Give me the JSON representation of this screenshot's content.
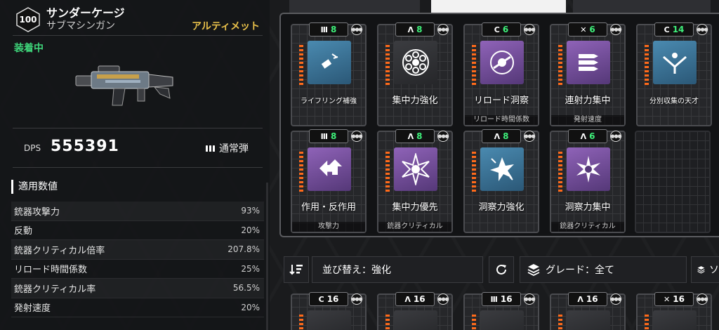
{
  "weapon": {
    "level": "100",
    "name": "サンダーケージ",
    "type": "サブマシンガン",
    "rarity": "アルティメット",
    "status": "装着中",
    "dps_label": "DPS",
    "dps_value": "555391",
    "ammo_label": "通常弾"
  },
  "stats": {
    "title": "適用数値",
    "rows": [
      {
        "label": "銃器攻撃力",
        "value": "93%"
      },
      {
        "label": "反動",
        "value": "20%"
      },
      {
        "label": "銃器クリティカル倍率",
        "value": "207.8%"
      },
      {
        "label": "リロード時間係数",
        "value": "25%"
      },
      {
        "label": "銃器クリティカル率",
        "value": "56.5%"
      },
      {
        "label": "発射速度",
        "value": "20%"
      }
    ]
  },
  "modules": [
    {
      "name": "ライフリング補強",
      "cost": "8",
      "polarity": "Ⅲ",
      "sub": "",
      "art": "blue",
      "glyph": "bullet-icon"
    },
    {
      "name": "集中力強化",
      "cost": "8",
      "polarity": "Λ",
      "sub": "",
      "art": "dark",
      "glyph": "cylinder-icon"
    },
    {
      "name": "リロード洞察",
      "cost": "6",
      "polarity": "C",
      "sub": "リロード時間係数",
      "art": "purple",
      "glyph": "reload-icon"
    },
    {
      "name": "連射力集中",
      "cost": "6",
      "polarity": "✕",
      "sub": "発射速度",
      "art": "purple",
      "glyph": "bullets-icon"
    },
    {
      "name": "分別収集の天才",
      "cost": "14",
      "polarity": "C",
      "sub": "",
      "art": "blue",
      "glyph": "collect-icon"
    },
    {
      "name": "作用・反作用",
      "cost": "8",
      "polarity": "Ⅲ",
      "sub": "攻撃力",
      "art": "purple",
      "glyph": "recoil-icon"
    },
    {
      "name": "集中力優先",
      "cost": "8",
      "polarity": "Λ",
      "sub": "銃器クリティカル",
      "art": "purple",
      "glyph": "burst-icon"
    },
    {
      "name": "洞察力強化",
      "cost": "8",
      "polarity": "Λ",
      "sub": "",
      "art": "blue",
      "glyph": "spark-icon"
    },
    {
      "name": "洞察力集中",
      "cost": "6",
      "polarity": "Λ",
      "sub": "銃器クリティカル",
      "art": "purple",
      "glyph": "focus-icon"
    }
  ],
  "sort": {
    "sort_label": "並び替え：強化",
    "grade_label": "グレード：全て",
    "extra_label": "ソ"
  },
  "inventory": [
    {
      "cost": "16",
      "polarity": "C"
    },
    {
      "cost": "16",
      "polarity": "Λ"
    },
    {
      "cost": "16",
      "polarity": "Ⅲ"
    },
    {
      "cost": "16",
      "polarity": "Λ"
    },
    {
      "cost": "16",
      "polarity": "✕"
    }
  ],
  "colors": {
    "accent_green": "#3ef07a",
    "rarity_gold": "#e8c04a",
    "bar_orange": "#ff6a1a"
  }
}
